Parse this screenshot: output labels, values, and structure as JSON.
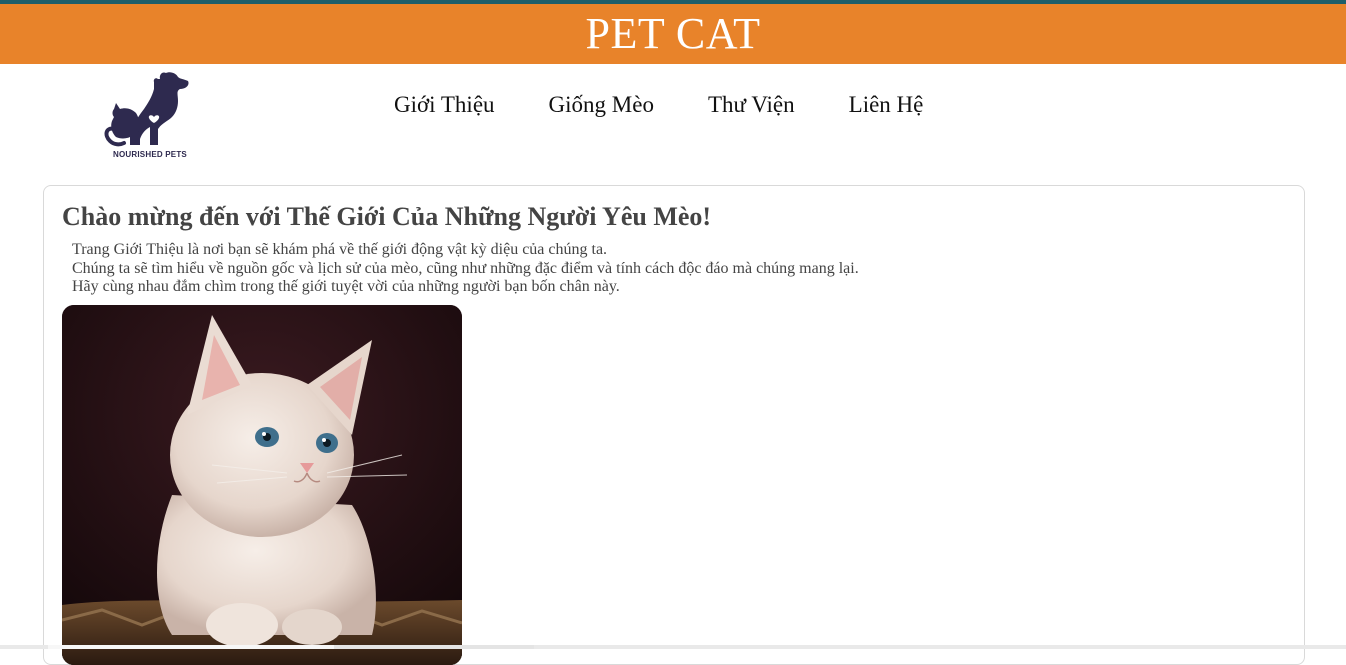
{
  "header": {
    "title": "PET CAT",
    "strip_color": "#1e5e6a",
    "banner_color": "#e8832a"
  },
  "logo": {
    "text": "NOURISHED PETS",
    "icon": "dog-cat-heart-icon",
    "color": "#2e2a4f"
  },
  "nav": {
    "items": [
      {
        "label": "Giới Thiệu"
      },
      {
        "label": "Giống Mèo"
      },
      {
        "label": "Thư Viện"
      },
      {
        "label": "Liên Hệ"
      }
    ]
  },
  "main": {
    "title": "Chào mừng đến với Thế Giới Của Những Người Yêu Mèo!",
    "paragraphs": [
      "Trang Giới Thiệu là nơi bạn sẽ khám phá về thế giới động vật kỳ diệu của chúng ta.",
      "Chúng ta sẽ tìm hiểu về nguồn gốc và lịch sử của mèo, cũng như những đặc điểm và tính cách độc đáo mà chúng mang lại.",
      "Hãy cùng nhau đắm chìm trong thế giới tuyệt vời của những người bạn bốn chân này."
    ],
    "image": {
      "subject": "white-kitten-photo"
    }
  }
}
